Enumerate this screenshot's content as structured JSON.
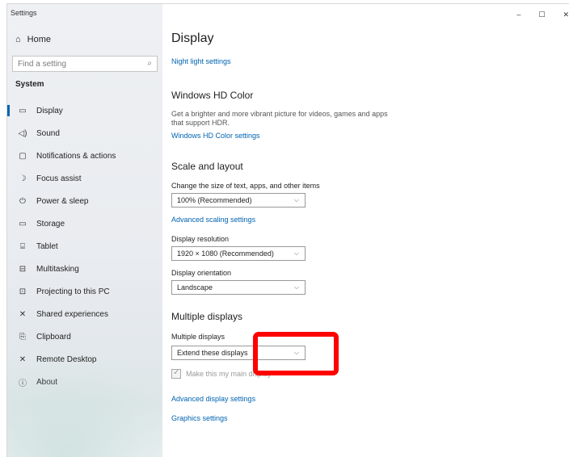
{
  "window": {
    "title": "Settings",
    "minimize": "–",
    "maximize": "☐",
    "close": "✕"
  },
  "sidebar": {
    "home": {
      "icon": "⌂",
      "label": "Home"
    },
    "search": {
      "placeholder": "Find a setting",
      "icon": "⌕"
    },
    "section": "System",
    "items": [
      {
        "icon": "▭",
        "label": "Display",
        "selected": true
      },
      {
        "icon": "◁)",
        "label": "Sound"
      },
      {
        "icon": "▢",
        "label": "Notifications & actions"
      },
      {
        "icon": "☽",
        "label": "Focus assist"
      },
      {
        "icon": "⏻",
        "label": "Power & sleep"
      },
      {
        "icon": "▭",
        "label": "Storage"
      },
      {
        "icon": "⌸",
        "label": "Tablet"
      },
      {
        "icon": "⊟",
        "label": "Multitasking"
      },
      {
        "icon": "⊡",
        "label": "Projecting to this PC"
      },
      {
        "icon": "✕",
        "label": "Shared experiences"
      },
      {
        "icon": "⎘",
        "label": "Clipboard"
      },
      {
        "icon": "✕",
        "label": "Remote Desktop"
      },
      {
        "icon": "ⓘ",
        "label": "About"
      }
    ]
  },
  "main": {
    "title": "Display",
    "night_light_link": "Night light settings",
    "hd_color": {
      "heading": "Windows HD Color",
      "description": "Get a brighter and more vibrant picture for videos, games and apps that support HDR.",
      "link": "Windows HD Color settings"
    },
    "scale_layout": {
      "heading": "Scale and layout",
      "scale_label": "Change the size of text, apps, and other items",
      "scale_value": "100% (Recommended)",
      "advanced_scaling_link": "Advanced scaling settings",
      "resolution_label": "Display resolution",
      "resolution_value": "1920 × 1080 (Recommended)",
      "orientation_label": "Display orientation",
      "orientation_value": "Landscape"
    },
    "multiple_displays": {
      "heading": "Multiple displays",
      "label": "Multiple displays",
      "value": "Extend these displays",
      "checkbox_label": "Make this my main display",
      "advanced_link": "Advanced display settings",
      "graphics_link": "Graphics settings"
    }
  },
  "colors": {
    "accent": "#0063b1",
    "annotation": "#ff0000"
  },
  "icons": {
    "chevron": "⌵",
    "check": "✓"
  }
}
